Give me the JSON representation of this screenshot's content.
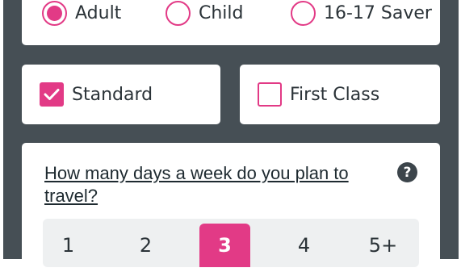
{
  "ticket_type": {
    "options": [
      {
        "label": "Adult",
        "selected": true
      },
      {
        "label": "Child",
        "selected": false
      },
      {
        "label": "16-17 Saver",
        "selected": false
      }
    ]
  },
  "travel_class": {
    "options": [
      {
        "label": "Standard",
        "checked": true
      },
      {
        "label": "First Class",
        "checked": false
      }
    ]
  },
  "frequency": {
    "question": "How many days a week do you plan to travel?",
    "help_icon": "?",
    "days": [
      "1",
      "2",
      "3",
      "4",
      "5+"
    ],
    "selected_day": "3"
  },
  "colors": {
    "accent": "#e23a86",
    "frame": "#464f55",
    "text": "#2b3338"
  },
  "icons": {
    "check": "checkmark-icon",
    "help": "question-mark-icon"
  }
}
